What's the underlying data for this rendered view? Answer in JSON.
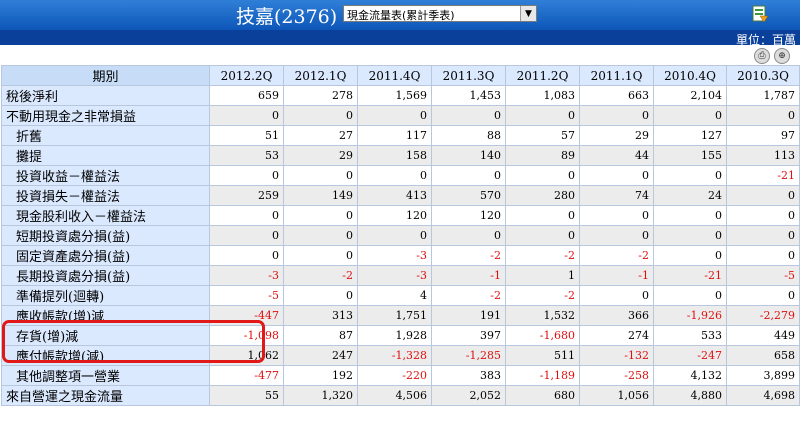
{
  "header": {
    "title": "技嘉(2376)",
    "report_select": "現金流量表(累計季表)",
    "unit": "單位：百萬"
  },
  "table": {
    "label_header": "期別",
    "periods": [
      "2012.2Q",
      "2012.1Q",
      "2011.4Q",
      "2011.3Q",
      "2011.2Q",
      "2011.1Q",
      "2010.4Q",
      "2010.3Q"
    ],
    "rows": [
      {
        "label": "稅後淨利",
        "indent": false,
        "values": [
          "659",
          "278",
          "1,569",
          "1,453",
          "1,083",
          "663",
          "2,104",
          "1,787"
        ]
      },
      {
        "label": "不動用現金之非常損益",
        "indent": false,
        "values": [
          "0",
          "0",
          "0",
          "0",
          "0",
          "0",
          "0",
          "0"
        ]
      },
      {
        "label": "折舊",
        "indent": true,
        "values": [
          "51",
          "27",
          "117",
          "88",
          "57",
          "29",
          "127",
          "97"
        ]
      },
      {
        "label": "攤提",
        "indent": true,
        "values": [
          "53",
          "29",
          "158",
          "140",
          "89",
          "44",
          "155",
          "113"
        ]
      },
      {
        "label": "投資收益－權益法",
        "indent": true,
        "values": [
          "0",
          "0",
          "0",
          "0",
          "0",
          "0",
          "0",
          "-21"
        ]
      },
      {
        "label": "投資損失－權益法",
        "indent": true,
        "values": [
          "259",
          "149",
          "413",
          "570",
          "280",
          "74",
          "24",
          "0"
        ]
      },
      {
        "label": "現金股利收入－權益法",
        "indent": true,
        "values": [
          "0",
          "0",
          "120",
          "120",
          "0",
          "0",
          "0",
          "0"
        ]
      },
      {
        "label": "短期投資處分損(益)",
        "indent": true,
        "values": [
          "0",
          "0",
          "0",
          "0",
          "0",
          "0",
          "0",
          "0"
        ]
      },
      {
        "label": "固定資產處分損(益)",
        "indent": true,
        "values": [
          "0",
          "0",
          "-3",
          "-2",
          "-2",
          "-2",
          "0",
          "0"
        ]
      },
      {
        "label": "長期投資處分損(益)",
        "indent": true,
        "values": [
          "-3",
          "-2",
          "-3",
          "-1",
          "1",
          "-1",
          "-21",
          "-5"
        ]
      },
      {
        "label": "準備提列(迴轉)",
        "indent": true,
        "values": [
          "-5",
          "0",
          "4",
          "-2",
          "-2",
          "0",
          "0",
          "0"
        ]
      },
      {
        "label": "應收帳款(增)減",
        "indent": true,
        "values": [
          "-447",
          "313",
          "1,751",
          "191",
          "1,532",
          "366",
          "-1,926",
          "-2,279"
        ]
      },
      {
        "label": "存貨(增)減",
        "indent": true,
        "values": [
          "-1,098",
          "87",
          "1,928",
          "397",
          "-1,680",
          "274",
          "533",
          "449"
        ]
      },
      {
        "label": "應付帳款增(減)",
        "indent": true,
        "values": [
          "1,062",
          "247",
          "-1,328",
          "-1,285",
          "511",
          "-132",
          "-247",
          "658"
        ]
      },
      {
        "label": "其他調整項一營業",
        "indent": true,
        "values": [
          "-477",
          "192",
          "-220",
          "383",
          "-1,189",
          "-258",
          "4,132",
          "3,899"
        ]
      },
      {
        "label": "來自營運之現金流量",
        "indent": false,
        "values": [
          "55",
          "1,320",
          "4,506",
          "2,052",
          "680",
          "1,056",
          "4,880",
          "4,698"
        ]
      }
    ]
  },
  "colors": {
    "title_bar": "#0d56b8",
    "unit_bar": "#0a3f9a",
    "label_bg": "#dbe9ff",
    "negative": "#e01010",
    "highlight": "#e01818"
  },
  "icons": {
    "export": "excel-export-icon",
    "print": "print-icon",
    "zoom": "zoom-icon",
    "dropdown": "chevron-down-icon"
  }
}
